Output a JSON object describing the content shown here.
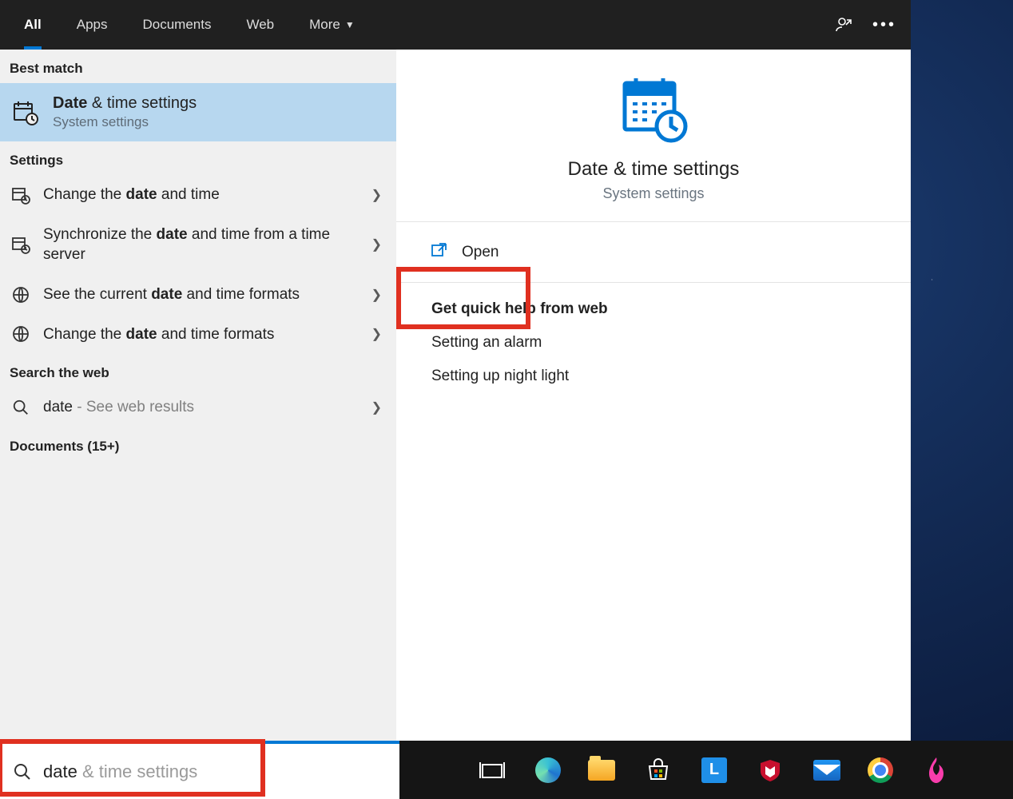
{
  "tabs": {
    "all": "All",
    "apps": "Apps",
    "documents": "Documents",
    "web": "Web",
    "more": "More"
  },
  "left": {
    "best_match_h": "Best match",
    "match_title_pre": "Date",
    "match_title_post": " & time settings",
    "match_sub": "System settings",
    "settings_h": "Settings",
    "row1_pre": "Change the ",
    "row1_bold": "date",
    "row1_post": " and time",
    "row2_pre": "Synchronize the ",
    "row2_bold": "date",
    "row2_post": " and time from a time server",
    "row3_pre": "See the current ",
    "row3_bold": "date",
    "row3_post": " and time formats",
    "row4_pre": "Change the ",
    "row4_bold": "date",
    "row4_post": " and time formats",
    "search_web_h": "Search the web",
    "web_term": "date",
    "web_sub": " - See web results",
    "docs_h": "Documents (15+)"
  },
  "right": {
    "title": "Date & time settings",
    "sub": "System settings",
    "open": "Open",
    "help_h": "Get quick help from web",
    "help1": "Setting an alarm",
    "help2": "Setting up night light"
  },
  "search": {
    "typed": "date",
    "ghost": " & time settings"
  }
}
